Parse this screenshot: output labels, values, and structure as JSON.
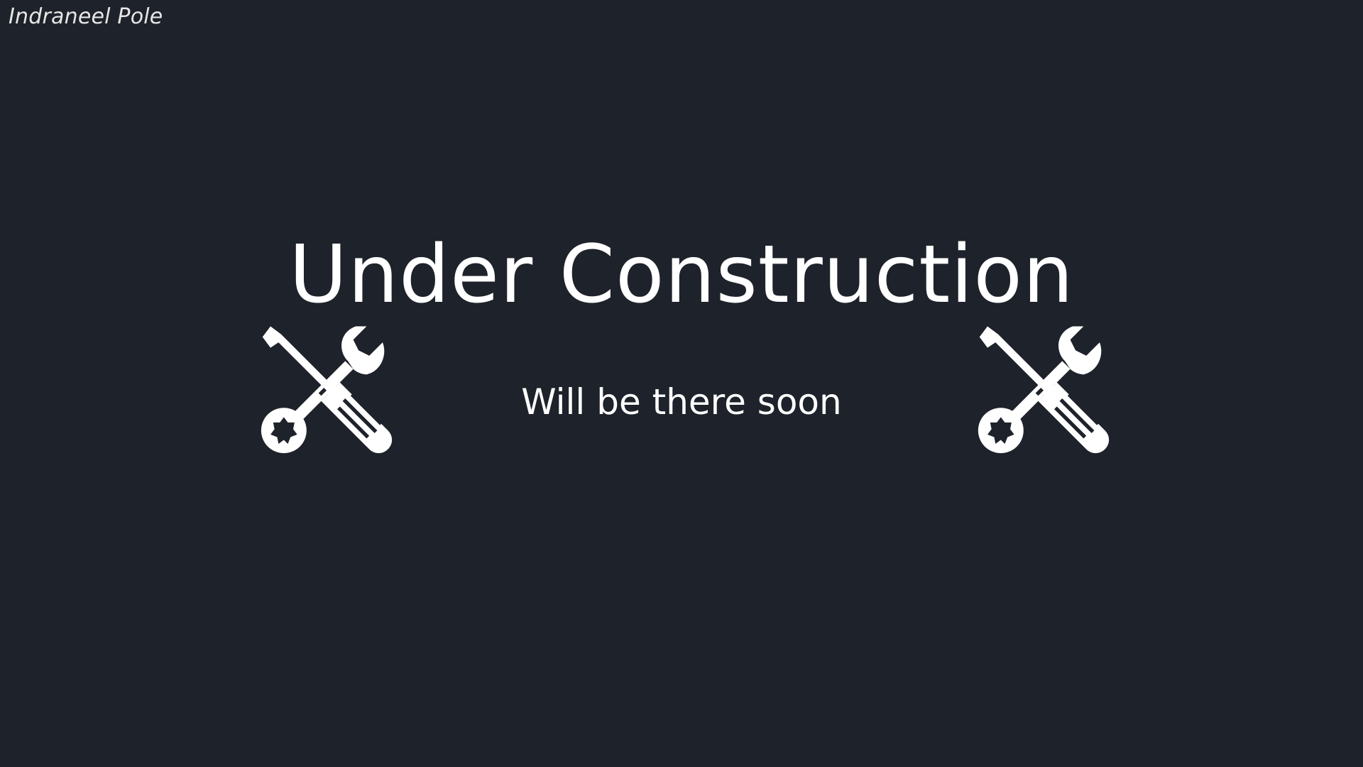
{
  "header": {
    "author": "Indraneel Pole"
  },
  "main": {
    "title": "Under Construction",
    "subtitle": "Will be there soon",
    "icons": [
      "wrench-screwdriver-icon",
      "wrench-screwdriver-icon"
    ]
  },
  "colors": {
    "background": "#1e222a",
    "text": "#ffffff"
  }
}
